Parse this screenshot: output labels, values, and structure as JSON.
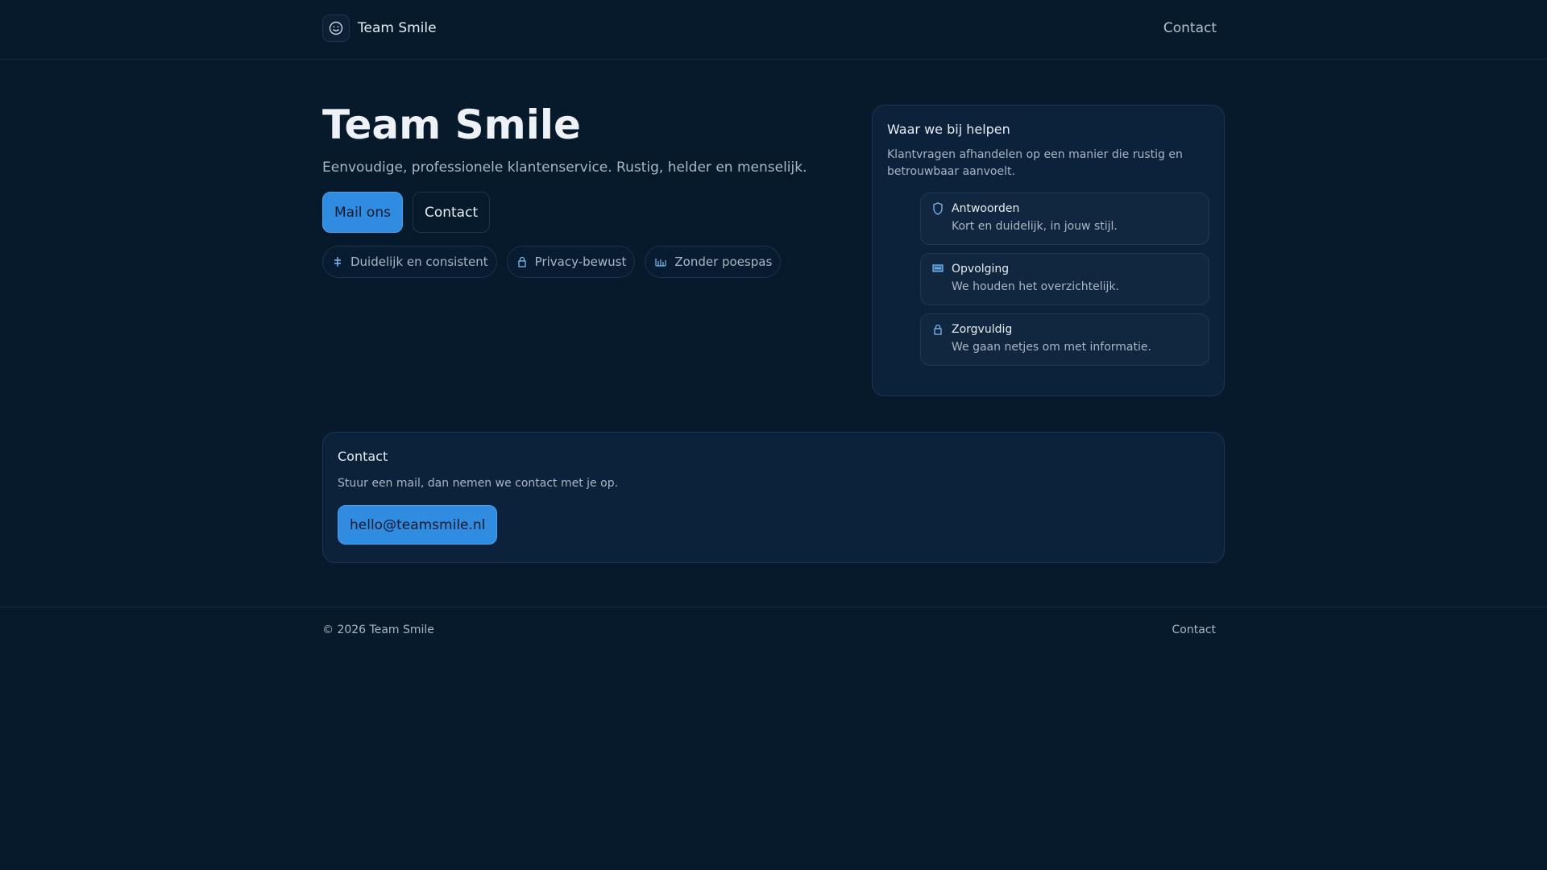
{
  "header": {
    "brand": "Team Smile",
    "nav_contact": "Contact"
  },
  "hero": {
    "title": "Team Smile",
    "subtitle": "Eenvoudige, professionele klantenservice. Rustig, helder en menselijk.",
    "primary_button": "Mail ons",
    "secondary_button": "Contact",
    "chips": [
      {
        "icon": "align-icon",
        "label": "Duidelijk en consistent"
      },
      {
        "icon": "lock-icon",
        "label": "Privacy-bewust"
      },
      {
        "icon": "bars-icon",
        "label": "Zonder poespas"
      }
    ]
  },
  "help": {
    "title": "Waar we bij helpen",
    "description": "Klantvragen afhandelen op een manier die rustig en betrouwbaar aanvoelt.",
    "items": [
      {
        "icon": "shield-icon",
        "title": "Antwoorden",
        "text": "Kort en duidelijk, in jouw stijl."
      },
      {
        "icon": "inbox-icon",
        "title": "Opvolging",
        "text": "We houden het overzichtelijk."
      },
      {
        "icon": "lock-icon",
        "title": "Zorgvuldig",
        "text": "We gaan netjes om met informatie."
      }
    ]
  },
  "contact": {
    "title": "Contact",
    "text": "Stuur een mail, dan nemen we contact met je op.",
    "email": "hello@teamsmile.nl"
  },
  "footer": {
    "copyright": "© 2026 Team Smile",
    "contact": "Contact"
  },
  "colors": {
    "background": "#061a2b",
    "card": "#0c213a",
    "accent": "#2f8ce0",
    "icon": "#7fb8ee"
  }
}
